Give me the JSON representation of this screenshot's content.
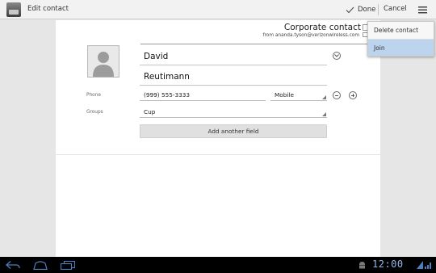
{
  "action_bar": {
    "title": "Edit contact",
    "done_label": "Done",
    "cancel_label": "Cancel"
  },
  "overflow_menu": {
    "items": [
      {
        "label": "Delete contact",
        "highlighted": false
      },
      {
        "label": "Join",
        "highlighted": true
      }
    ]
  },
  "contact": {
    "account_title": "Corporate contact",
    "account_from": "from ananda.tyson@verizonwireless.com",
    "first_name": "David",
    "last_name": "Reutimann",
    "phone_label": "Phone",
    "phone_value": "(999) 555-3333",
    "phone_type": "Mobile",
    "groups_label": "Groups",
    "groups_value": "Cup",
    "add_field_label": "Add another field"
  },
  "system_bar": {
    "clock": "12:00"
  },
  "colors": {
    "menu_highlight": "#bcd4ee",
    "clock": "#8fb8e8",
    "system_bar": "#000000"
  }
}
